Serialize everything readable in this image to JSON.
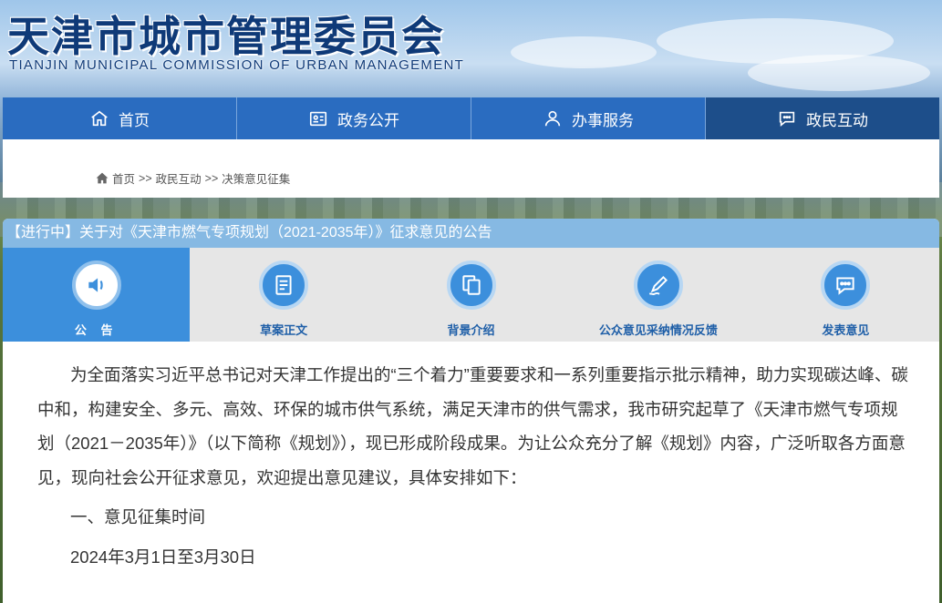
{
  "header": {
    "title_cn": "天津市城市管理委员会",
    "title_en": "TIANJIN MUNICIPAL COMMISSION OF URBAN MANAGEMENT"
  },
  "nav": {
    "items": [
      {
        "label": "首页",
        "icon": "home-icon"
      },
      {
        "label": "政务公开",
        "icon": "id-card-icon"
      },
      {
        "label": "办事服务",
        "icon": "user-icon"
      },
      {
        "label": "政民互动",
        "icon": "chat-icon"
      }
    ],
    "active_index": 3,
    "active_color": "#1d4e8a",
    "color": "#2a6cc0"
  },
  "breadcrumb": {
    "home": "首页",
    "sep": ">>",
    "level1": "政民互动",
    "level2": "决策意见征集"
  },
  "panel": {
    "title": "【进行中】关于对《天津市燃气专项规划（2021-2035年）》征求意见的公告",
    "tabs": [
      {
        "label": "公 告",
        "icon": "speaker-icon"
      },
      {
        "label": "草案正文",
        "icon": "document-icon"
      },
      {
        "label": "背景介绍",
        "icon": "copy-icon"
      },
      {
        "label": "公众意见采纳情况反馈",
        "icon": "pen-icon"
      },
      {
        "label": "发表意见",
        "icon": "comment-icon"
      }
    ],
    "active_tab": 0
  },
  "content": {
    "paragraph1": "为全面落实习近平总书记对天津工作提出的“三个着力”重要要求和一系列重要指示批示精神，助力实现碳达峰、碳中和，构建安全、多元、高效、环保的城市供气系统，满足天津市的供气需求，我市研究起草了《天津市燃气专项规划（2021－2035年）》（以下简称《规划》），现已形成阶段成果。为让公众充分了解《规划》内容，广泛听取各方面意见，现向社会公开征求意见，欢迎提出意见建议，具体安排如下：",
    "section1_title": "一、意见征集时间",
    "section1_text": "2024年3月1日至3月30日"
  }
}
